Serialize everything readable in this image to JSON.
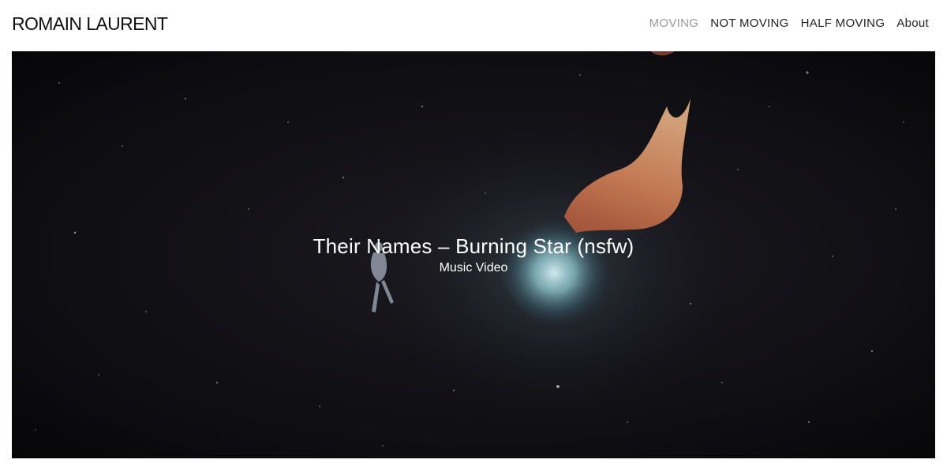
{
  "site": {
    "logo": "ROMAIN LAURENT"
  },
  "nav": {
    "items": [
      {
        "label": "MOVING",
        "active": true
      },
      {
        "label": "NOT MOVING",
        "active": false
      },
      {
        "label": "HALF MOVING",
        "active": false
      },
      {
        "label": "About",
        "active": false
      }
    ]
  },
  "hero": {
    "title": "Their Names – Burning Star (nsfw)",
    "subtitle": "Music Video"
  },
  "colors": {
    "nav_active": "#9a9a9a",
    "nav_default": "#222222",
    "hero_background": "#121116"
  }
}
